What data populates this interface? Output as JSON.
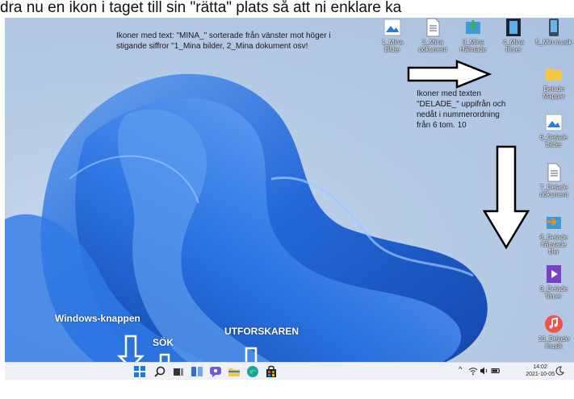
{
  "page_caption": "dra nu en ikon i taget till sin \"rätta\" plats så att ni enklare ka",
  "annotations": {
    "mina_note_line1": "Ikoner med text: \"MINA_\" sorterade från vänster mot höger i",
    "mina_note_line2": "stigande siffror \"1_Mina bilder, 2_Mina dokument osv!",
    "delade_note_line1": "Ikoner med texten",
    "delade_note_line2": "\"DELADE_\" uppifrån och",
    "delade_note_line3": "nedåt i nummerordning",
    "delade_note_line4": "från 6 tom. 10",
    "windows_button_label": "Windows-knappen",
    "search_label": "SÖK",
    "explorer_label": "UTFORSKAREN"
  },
  "top_icons": [
    {
      "label": "1_Mina bilder",
      "icon": "pictures-icon"
    },
    {
      "label": "2_Mina dokument",
      "icon": "document-icon"
    },
    {
      "label": "3_Mina Hämtade",
      "icon": "downloads-icon"
    },
    {
      "label": "4_Mina filmer",
      "icon": "film-icon"
    },
    {
      "label": "5_Min musik",
      "icon": "phone-music-icon"
    }
  ],
  "side_icons": [
    {
      "label": "Delade Mappar",
      "icon": "folder-icon"
    },
    {
      "label": "6_Delade bilder",
      "icon": "pictures-icon"
    },
    {
      "label": "7_Delade dokument",
      "icon": "document-icon"
    },
    {
      "label": "8_Delade hämtade filer",
      "icon": "downloads-icon"
    },
    {
      "label": "9_Delade filmer",
      "icon": "film-icon"
    },
    {
      "label": "10_Delade musik",
      "icon": "music-icon"
    }
  ],
  "taskbar": {
    "time": "14:02",
    "date": "2021-10-05"
  },
  "colors": {
    "accent_blue": "#1f5fd6",
    "taskbar_bg": "#eef1f6"
  }
}
